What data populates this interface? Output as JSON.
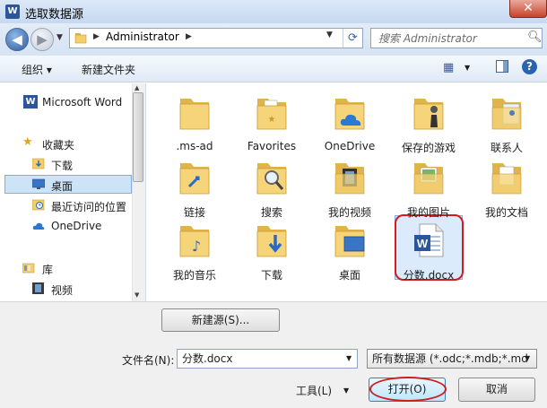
{
  "window": {
    "title": "选取数据源",
    "app_icon": "W",
    "close_glyph": "✕"
  },
  "address": {
    "path": "Administrator",
    "search_placeholder": "搜索 Administrator"
  },
  "toolbar": {
    "organize": "组织 ▾",
    "new_folder": "新建文件夹"
  },
  "nav": {
    "items": [
      {
        "label": "Microsoft Word",
        "icon": "word-icon"
      },
      {
        "label": "收藏夹",
        "icon": "star-icon"
      },
      {
        "label": "下载",
        "icon": "download-folder-icon"
      },
      {
        "label": "桌面",
        "icon": "desktop-icon"
      },
      {
        "label": "最近访问的位置",
        "icon": "recent-icon"
      },
      {
        "label": "OneDrive",
        "icon": "cloud-icon"
      },
      {
        "label": "库",
        "icon": "library-icon"
      },
      {
        "label": "视频",
        "icon": "video-icon"
      }
    ]
  },
  "files": [
    {
      "label": ".ms-ad"
    },
    {
      "label": "Favorites"
    },
    {
      "label": "OneDrive"
    },
    {
      "label": "保存的游戏"
    },
    {
      "label": "联系人"
    },
    {
      "label": "链接"
    },
    {
      "label": "搜索"
    },
    {
      "label": "我的视频"
    },
    {
      "label": "我的图片"
    },
    {
      "label": "我的文档"
    },
    {
      "label": "我的音乐"
    },
    {
      "label": "下载"
    },
    {
      "label": "桌面"
    },
    {
      "label": "分数.docx"
    }
  ],
  "bottom": {
    "new_source": "新建源(S)...",
    "filename_label": "文件名(N):",
    "filename_value": "分数.docx",
    "filetype_value": "所有数据源 (*.odc;*.mdb;*.md",
    "tools": "工具(L)",
    "open": "打开(O)",
    "cancel": "取消"
  },
  "colors": {
    "accent": "#3c7fb1",
    "highlight_ring": "#d11c1c",
    "folder": "#f3cf6c"
  }
}
